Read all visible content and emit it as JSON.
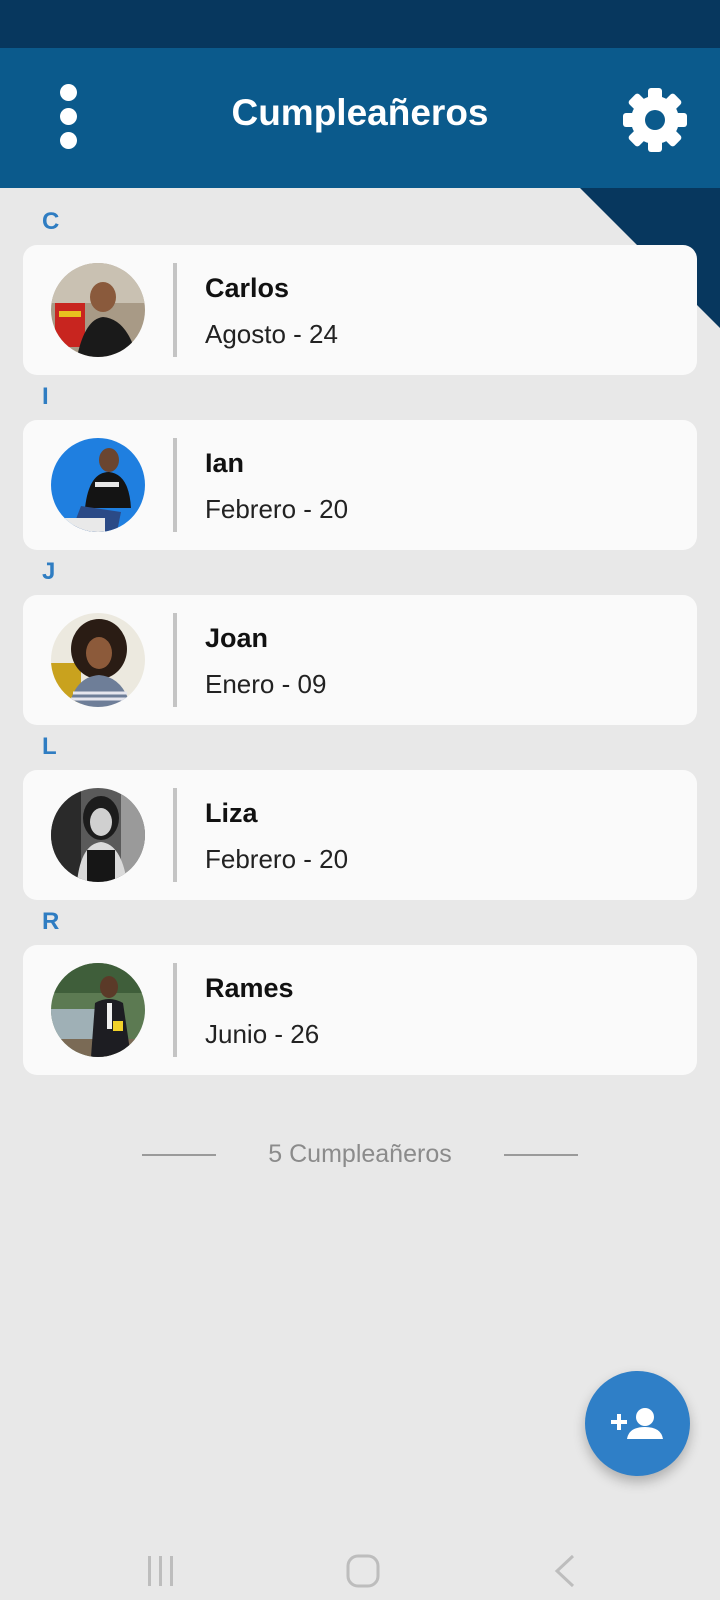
{
  "app_bar": {
    "title": "Cumpleañeros"
  },
  "contacts": [
    {
      "letter": "C",
      "name": "Carlos",
      "date": "Agosto - 24"
    },
    {
      "letter": "I",
      "name": "Ian",
      "date": "Febrero - 20"
    },
    {
      "letter": "J",
      "name": "Joan",
      "date": "Enero - 09"
    },
    {
      "letter": "L",
      "name": "Liza",
      "date": "Febrero - 20"
    },
    {
      "letter": "R",
      "name": "Rames",
      "date": "Junio - 26"
    }
  ],
  "footer": {
    "count_label": "5 Cumpleañeros"
  },
  "icons": {
    "menu": "more-vertical-icon",
    "settings": "gear-icon",
    "fab": "add-person-icon",
    "nav_recent": "recent-apps-icon",
    "nav_home": "home-icon",
    "nav_back": "back-icon"
  },
  "colors": {
    "status_bar": "#07375e",
    "app_bar": "#0b5a8c",
    "accent": "#2f7dc2",
    "background": "#e8e8e8"
  }
}
